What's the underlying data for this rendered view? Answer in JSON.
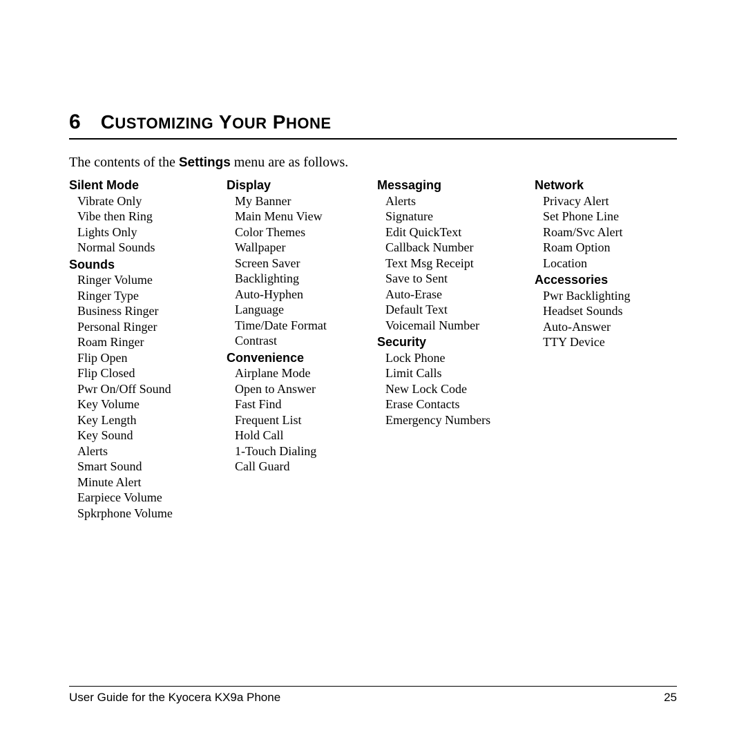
{
  "chapter_number": "6",
  "chapter_title_parts": [
    {
      "t": "C",
      "cls": "big"
    },
    {
      "t": "USTOMIZING",
      "cls": "small"
    },
    {
      "t": " Y",
      "cls": "big"
    },
    {
      "t": "OUR",
      "cls": "small"
    },
    {
      "t": " P",
      "cls": "big"
    },
    {
      "t": "HONE",
      "cls": "small"
    }
  ],
  "intro_prefix": "The contents of the ",
  "intro_bold": "Settings",
  "intro_suffix": " menu are as follows.",
  "columns": [
    [
      {
        "heading": "Silent Mode",
        "items": [
          "Vibrate Only",
          "Vibe then Ring",
          "Lights Only",
          "Normal Sounds"
        ]
      },
      {
        "heading": "Sounds",
        "items": [
          "Ringer Volume",
          "Ringer Type",
          "Business Ringer",
          "Personal Ringer",
          "Roam Ringer",
          "Flip Open",
          "Flip Closed",
          "Pwr On/Off Sound",
          "Key Volume",
          "Key Length",
          "Key Sound",
          "Alerts",
          "Smart Sound",
          "Minute Alert",
          "Earpiece Volume",
          "Spkrphone Volume"
        ]
      }
    ],
    [
      {
        "heading": "Display",
        "items": [
          "My Banner",
          "Main Menu View",
          "Color Themes",
          "Wallpaper",
          "Screen Saver",
          "Backlighting",
          "Auto-Hyphen",
          "Language",
          "Time/Date Format",
          "Contrast"
        ]
      },
      {
        "heading": "Convenience",
        "items": [
          "Airplane Mode",
          "Open to Answer",
          "Fast Find",
          "Frequent List",
          "Hold Call",
          "1-Touch Dialing",
          "Call Guard"
        ]
      }
    ],
    [
      {
        "heading": "Messaging",
        "items": [
          "Alerts",
          "Signature",
          "Edit QuickText",
          "Callback Number",
          "Text Msg Receipt",
          "Save to Sent",
          "Auto-Erase",
          "Default Text",
          "Voicemail Number"
        ]
      },
      {
        "heading": "Security",
        "items": [
          "Lock Phone",
          "Limit Calls",
          "New Lock Code",
          "Erase Contacts",
          "Emergency Numbers"
        ]
      }
    ],
    [
      {
        "heading": "Network",
        "items": [
          "Privacy Alert",
          "Set Phone Line",
          "Roam/Svc Alert",
          "Roam Option",
          "Location"
        ]
      },
      {
        "heading": "Accessories",
        "items": [
          "Pwr Backlighting",
          "Headset Sounds",
          "Auto-Answer",
          "TTY Device"
        ]
      }
    ]
  ],
  "footer_left": "User Guide for the Kyocera KX9a Phone",
  "footer_right": "25"
}
